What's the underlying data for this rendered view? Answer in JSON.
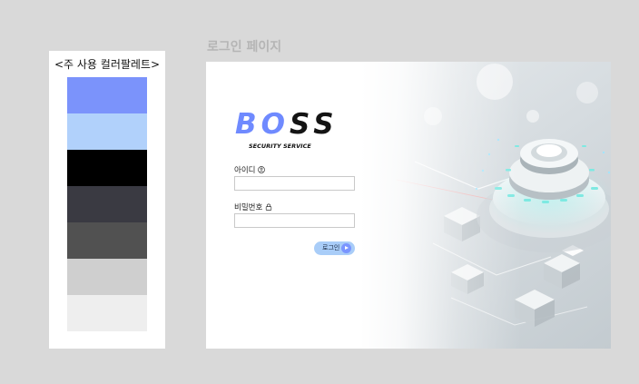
{
  "palette": {
    "title": "<주 사용 컬러팔레트>",
    "colors": [
      "#7b93fb",
      "#b1d1fb",
      "#000000",
      "#3a3a42",
      "#515151",
      "#cfcfcf",
      "#eeeeee"
    ]
  },
  "page_title": "로그인 페이지",
  "login": {
    "logo_text": "BOSS",
    "logo_tagline": "SECURITY SERVICE",
    "logo_colors": {
      "b": "#6f8aff",
      "o": "#6f8aff",
      "s": "#141414"
    },
    "id_label": "아이디",
    "id_icon": "user-circle-icon",
    "id_value": "",
    "password_label": "비밀번호",
    "password_icon": "lock-icon",
    "password_value": "",
    "login_button_label": "로그인",
    "login_button_icon": "arrow-right-icon",
    "button_color": "#a9cdf8",
    "accent_color": "#7a95ff"
  }
}
